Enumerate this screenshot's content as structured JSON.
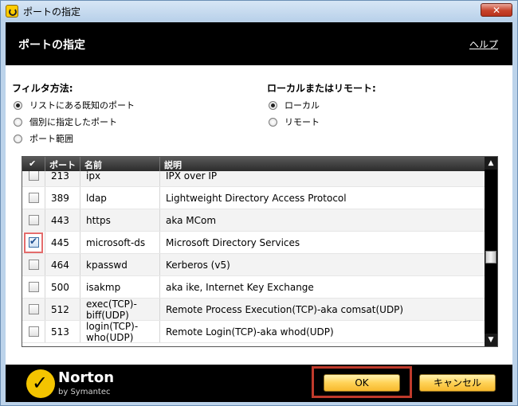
{
  "window": {
    "title": "ポートの指定",
    "close_label": "✕"
  },
  "header": {
    "title": "ポートの指定",
    "help": "ヘルプ"
  },
  "filter": {
    "label": "フィルタ方法:",
    "options": [
      "リストにある既知のポート",
      "個別に指定したポート",
      "ポート範囲"
    ],
    "selected_index": 0
  },
  "location": {
    "label": "ローカルまたはリモート:",
    "options": [
      "ローカル",
      "リモート"
    ],
    "selected_index": 0
  },
  "table": {
    "columns": [
      "✔",
      "ポート",
      "名前",
      "説明"
    ],
    "rows": [
      {
        "checked": false,
        "port": "213",
        "name": "ipx",
        "description": "IPX over IP"
      },
      {
        "checked": false,
        "port": "389",
        "name": "ldap",
        "description": "Lightweight Directory Access Protocol"
      },
      {
        "checked": false,
        "port": "443",
        "name": "https",
        "description": "aka MCom"
      },
      {
        "checked": true,
        "port": "445",
        "name": "microsoft-ds",
        "description": "Microsoft Directory Services"
      },
      {
        "checked": false,
        "port": "464",
        "name": "kpasswd",
        "description": "Kerberos (v5)"
      },
      {
        "checked": false,
        "port": "500",
        "name": "isakmp",
        "description": "aka ike, Internet Key Exchange"
      },
      {
        "checked": false,
        "port": "512",
        "name": "exec(TCP)-\nbiff(UDP)",
        "description": "Remote Process Execution(TCP)-aka comsat(UDP)"
      },
      {
        "checked": false,
        "port": "513",
        "name": "login(TCP)-\nwho(UDP)",
        "description": "Remote Login(TCP)-aka whod(UDP)"
      }
    ]
  },
  "brand": {
    "name": "Norton",
    "sub": "by Symantec"
  },
  "buttons": {
    "ok": "OK",
    "cancel": "キャンセル"
  },
  "colors": {
    "accent": "#ffd257",
    "highlight": "#c03a2b"
  }
}
